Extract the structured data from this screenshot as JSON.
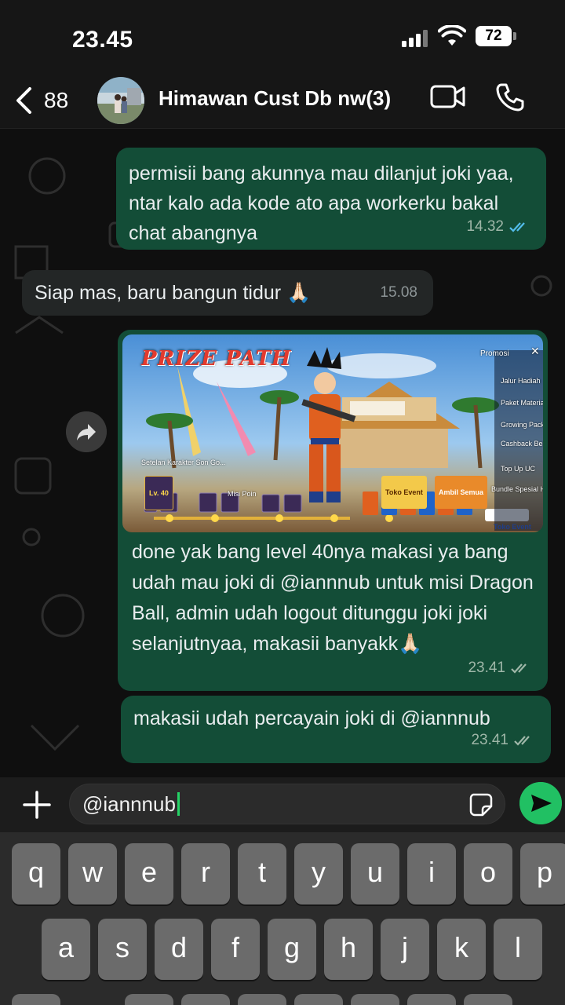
{
  "status": {
    "time": "23.45",
    "battery": "72"
  },
  "header": {
    "back_count": "88",
    "title": "Himawan Cust Db nw(3)"
  },
  "messages": [
    {
      "direction": "out",
      "text": "permisii bang akunnya mau dilanjut joki yaa, ntar kalo ada kode ato apa workerku bakal chat abangnya",
      "time": "14.32",
      "status": "read"
    },
    {
      "direction": "in",
      "text": "Siap mas, baru bangun tidur 🙏🏻",
      "time": "15.08"
    },
    {
      "direction": "out",
      "type": "image",
      "text": "done yak bang level 40nya makasi ya bang udah mau joki di @iannnub untuk misi Dragon Ball, admin udah logout ditunggu joki joki selanjutnyaa, makasii banyakk🙏🏻",
      "time": "23.41",
      "status": "delivered"
    },
    {
      "direction": "out",
      "text": "makasii udah percayain joki di @iannnub",
      "time": "23.41",
      "status": "delivered"
    }
  ],
  "image_text": {
    "logo": "PRIZE PATH",
    "promo": "Promosi",
    "level": "Lv. 40",
    "misi": "Misi Poin",
    "toko_event": "Toko Event",
    "ambil_semua": "Ambil Semua",
    "toko_event_btn": "Toko Event",
    "menu": [
      "Jalur Hadiah",
      "Paket Material",
      "Growing Pack",
      "Cashback Besar",
      "Top Up UC",
      "Bundle Spesial Harian"
    ],
    "setelan": "Setelan Karakter Son Go..."
  },
  "composer": {
    "value": "@iannnub"
  },
  "keyboard": {
    "row1": [
      "q",
      "w",
      "e",
      "r",
      "t",
      "y",
      "u",
      "i",
      "o",
      "p"
    ],
    "row2": [
      "a",
      "s",
      "d",
      "f",
      "g",
      "h",
      "j",
      "k",
      "l"
    ]
  },
  "colors": {
    "outgoing": "#134d37",
    "incoming": "#232626",
    "accent": "#21c063"
  }
}
